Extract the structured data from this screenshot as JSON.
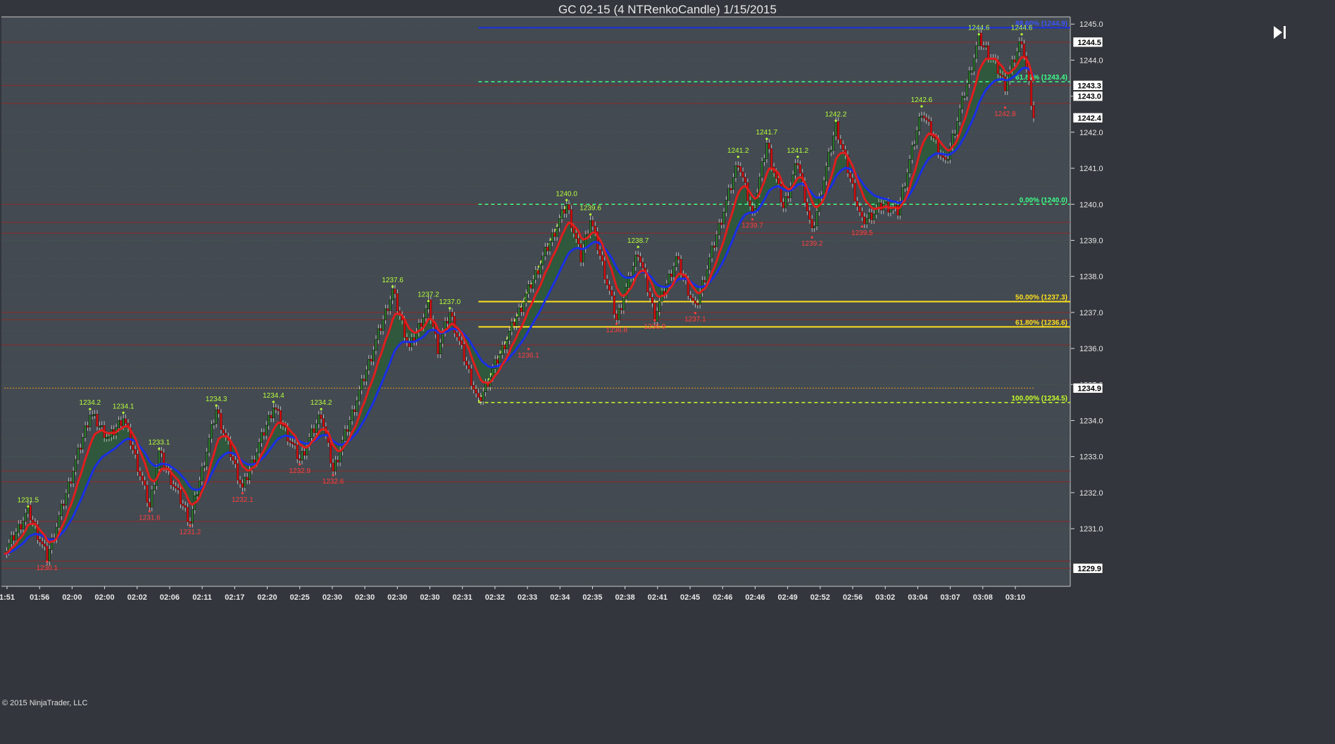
{
  "window": {
    "title": "GC 02-15 (4 NTRenkoCandle)  1/15/2015"
  },
  "copyright": "© 2015 NinjaTrader, LLC",
  "colors": {
    "background": "#434a51",
    "frame": "#33373d",
    "up_candle": "#2e8b2e",
    "down_candle": "#e01010",
    "fast_ma": "#e01e1e",
    "slow_ma": "#1a2fe6",
    "cloud": "#2c5a3a",
    "fib_yellow": "#ffe020",
    "fib_green": "#3dff8a",
    "fib_blue": "#1a2fe6",
    "swing_high": "#b8ff3c",
    "swing_low": "#ff4040"
  },
  "chart_data": {
    "type": "candlestick",
    "instrument": "GC 02-15",
    "bar_type": "4 NTRenkoCandle",
    "date": "1/15/2015",
    "ylim": [
      1229.4,
      1245.2
    ],
    "y_ticks": [
      "1245.0",
      "1244.0",
      "1243.0",
      "1242.0",
      "1241.0",
      "1240.0",
      "1239.0",
      "1238.0",
      "1237.0",
      "1236.0",
      "1235.0",
      "1234.0",
      "1233.0",
      "1232.0",
      "1231.0"
    ],
    "x_labels": [
      "1:51",
      "01:56",
      "02:00",
      "02:00",
      "02:02",
      "02:06",
      "02:11",
      "02:17",
      "02:20",
      "02:25",
      "02:30",
      "02:30",
      "02:30",
      "02:30",
      "02:31",
      "02:32",
      "02:33",
      "02:34",
      "02:35",
      "02:38",
      "02:41",
      "02:45",
      "02:46",
      "02:46",
      "02:49",
      "02:52",
      "02:56",
      "03:02",
      "03:04",
      "03:07",
      "03:08",
      "03:10"
    ],
    "price_path": [
      [
        0,
        1230.3
      ],
      [
        10,
        1231.5
      ],
      [
        18,
        1230.2
      ],
      [
        36,
        1234.2
      ],
      [
        44,
        1233.5
      ],
      [
        50,
        1234.1
      ],
      [
        61,
        1231.6
      ],
      [
        65,
        1233.1
      ],
      [
        78,
        1231.2
      ],
      [
        89,
        1234.3
      ],
      [
        100,
        1232.1
      ],
      [
        113,
        1234.4
      ],
      [
        124,
        1232.9
      ],
      [
        133,
        1234.2
      ],
      [
        138,
        1232.6
      ],
      [
        163,
        1237.6
      ],
      [
        170,
        1236.0
      ],
      [
        178,
        1237.2
      ],
      [
        182,
        1236.0
      ],
      [
        187,
        1237.0
      ],
      [
        199,
        1234.5
      ],
      [
        236,
        1240.0
      ],
      [
        242,
        1238.5
      ],
      [
        246,
        1239.6
      ],
      [
        257,
        1236.8
      ],
      [
        266,
        1238.7
      ],
      [
        273,
        1236.9
      ],
      [
        282,
        1238.5
      ],
      [
        290,
        1237.1
      ],
      [
        308,
        1241.2
      ],
      [
        314,
        1239.7
      ],
      [
        320,
        1241.7
      ],
      [
        327,
        1239.9
      ],
      [
        333,
        1241.2
      ],
      [
        339,
        1239.2
      ],
      [
        349,
        1242.2
      ],
      [
        360,
        1239.5
      ],
      [
        369,
        1240.0
      ],
      [
        375,
        1239.8
      ],
      [
        385,
        1242.6
      ],
      [
        395,
        1241.1
      ],
      [
        409,
        1244.6
      ],
      [
        415,
        1244.0
      ],
      [
        420,
        1243.3
      ],
      [
        427,
        1244.6
      ],
      [
        432,
        1242.4
      ]
    ],
    "last_price": 1242.4,
    "price_markers": [
      {
        "label": "1244.5",
        "price": 1244.5
      },
      {
        "label": "1243.3",
        "price": 1243.3
      },
      {
        "label": "1243.0",
        "price": 1243.0
      },
      {
        "label": "1242.4",
        "price": 1242.4
      },
      {
        "label": "1234.9",
        "price": 1234.9
      },
      {
        "label": "1229.9",
        "price": 1229.9
      }
    ],
    "swing_highs": [
      {
        "label": "1231.5",
        "bar": 10,
        "price": 1231.5
      },
      {
        "label": "1234.2",
        "bar": 36,
        "price": 1234.2
      },
      {
        "label": "1234.1",
        "bar": 50,
        "price": 1234.1
      },
      {
        "label": "1233.1",
        "bar": 65,
        "price": 1233.1
      },
      {
        "label": "1234.3",
        "bar": 89,
        "price": 1234.3
      },
      {
        "label": "1234.4",
        "bar": 113,
        "price": 1234.4
      },
      {
        "label": "1234.2",
        "bar": 133,
        "price": 1234.2
      },
      {
        "label": "1237.6",
        "bar": 163,
        "price": 1237.6
      },
      {
        "label": "1237.2",
        "bar": 178,
        "price": 1237.2
      },
      {
        "label": "1237.0",
        "bar": 187,
        "price": 1237.0
      },
      {
        "label": "1240.0",
        "bar": 236,
        "price": 1240.0
      },
      {
        "label": "1239.6",
        "bar": 246,
        "price": 1239.6
      },
      {
        "label": "1238.7",
        "bar": 266,
        "price": 1238.7
      },
      {
        "label": "1241.2",
        "bar": 308,
        "price": 1241.2
      },
      {
        "label": "1241.7",
        "bar": 320,
        "price": 1241.7
      },
      {
        "label": "1241.2",
        "bar": 333,
        "price": 1241.2
      },
      {
        "label": "1242.2",
        "bar": 349,
        "price": 1242.2
      },
      {
        "label": "1242.6",
        "bar": 385,
        "price": 1242.6
      },
      {
        "label": "1244.6",
        "bar": 409,
        "price": 1244.6
      },
      {
        "label": "1244.6",
        "bar": 427,
        "price": 1244.6
      }
    ],
    "swing_lows": [
      {
        "label": "1230.1",
        "bar": 18,
        "price": 1230.2
      },
      {
        "label": "1231.6",
        "bar": 61,
        "price": 1231.6
      },
      {
        "label": "1231.2",
        "bar": 78,
        "price": 1231.2
      },
      {
        "label": "1232.1",
        "bar": 100,
        "price": 1232.1
      },
      {
        "label": "1232.9",
        "bar": 124,
        "price": 1232.9
      },
      {
        "label": "1232.6",
        "bar": 138,
        "price": 1232.6
      },
      {
        "label": "1236.1",
        "bar": 220,
        "price": 1236.1
      },
      {
        "label": "1236.8",
        "bar": 257,
        "price": 1236.8
      },
      {
        "label": "1236.9",
        "bar": 273,
        "price": 1236.9
      },
      {
        "label": "1237.1",
        "bar": 290,
        "price": 1237.1
      },
      {
        "label": "1239.7",
        "bar": 314,
        "price": 1239.7
      },
      {
        "label": "1239.2",
        "bar": 339,
        "price": 1239.2
      },
      {
        "label": "1239.5",
        "bar": 360,
        "price": 1239.5
      },
      {
        "label": "1242.8",
        "bar": 420,
        "price": 1242.8
      }
    ],
    "fibonacci": {
      "anchor_low": {
        "bar": 199,
        "price": 1234.5
      },
      "anchor_high": {
        "bar": 236,
        "price": 1240.0
      },
      "levels": [
        {
          "label": "88.60% (1244.9)",
          "price": 1244.9,
          "style": "blue-solid"
        },
        {
          "label": "61.80% (1243.4)",
          "price": 1243.4,
          "style": "green-dashed"
        },
        {
          "label": "0.00% (1240.0)",
          "price": 1240.0,
          "style": "green-dashed"
        },
        {
          "label": "50.00% (1237.3)",
          "price": 1237.3,
          "style": "yellow-solid"
        },
        {
          "label": "61.80% (1236.6)",
          "price": 1236.6,
          "style": "yellow-solid"
        },
        {
          "label": "100.00% (1234.5)",
          "price": 1234.5,
          "style": "lime-dashed"
        }
      ]
    },
    "orange_dotted_level": 1234.9,
    "support_resistance_lines": [
      1244.5,
      1243.3,
      1242.8,
      1240.0,
      1239.5,
      1239.2,
      1237.0,
      1236.8,
      1236.1,
      1232.6,
      1232.3,
      1231.2,
      1230.1,
      1229.9
    ],
    "grid": true
  }
}
